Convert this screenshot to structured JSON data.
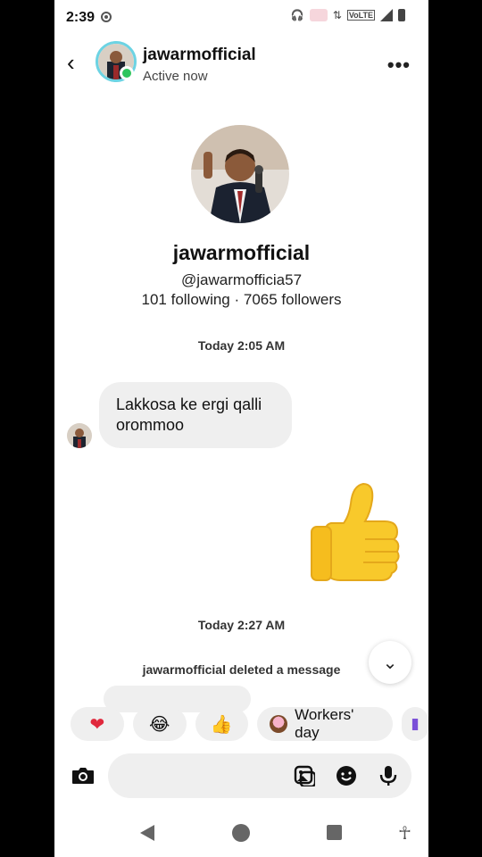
{
  "status_bar": {
    "time": "2:39",
    "network": "VoLTE"
  },
  "header": {
    "username": "jawarmofficial",
    "status": "Active now"
  },
  "profile": {
    "name": "jawarmofficial",
    "handle": "@jawarmofficia57",
    "stats": "101 following · 7065 followers"
  },
  "thread": {
    "timestamp_1": "Today 2:05 AM",
    "message_1": "Lakkosa ke ergi qalli orommoo",
    "timestamp_2": "Today 2:27 AM",
    "deleted_notice": "jawarmofficial deleted a message"
  },
  "quick_replies": [
    {
      "glyph": "❤",
      "label": "heart"
    },
    {
      "glyph": "😂",
      "label": "laughing"
    },
    {
      "glyph": "👍",
      "label": "thumbs-up"
    },
    {
      "glyph": "",
      "label": "Workers' day"
    }
  ],
  "colors": {
    "active": "#2ec55d",
    "ring": "#6cd3e3",
    "bubble": "#efefef",
    "heart": "#e0283c"
  }
}
